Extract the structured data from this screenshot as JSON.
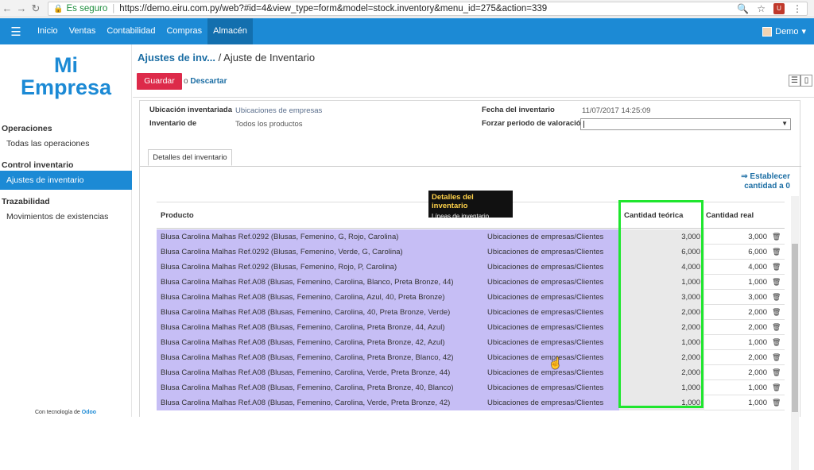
{
  "browser": {
    "secure_label": "Es seguro",
    "url": "https://demo.eiru.com.py/web?#id=4&view_type=form&model=stock.inventory&menu_id=275&action=339"
  },
  "topbar": {
    "menu": [
      "Inicio",
      "Ventas",
      "Contabilidad",
      "Compras",
      "Almacén"
    ],
    "active": "Almacén",
    "user": "Demo"
  },
  "sidebar": {
    "logo_line1": "Mi",
    "logo_line2": "Empresa",
    "sections": [
      {
        "title": "Operaciones",
        "items": [
          "Todas las operaciones"
        ]
      },
      {
        "title": "Control inventario",
        "items": [
          "Ajustes de inventario"
        ]
      },
      {
        "title": "Trazabilidad",
        "items": [
          "Movimientos de existencias"
        ]
      }
    ],
    "powered_prefix": "Con tecnología de",
    "powered_brand": "Odoo"
  },
  "header": {
    "breadcrumb_parent": "Ajustes de inv...",
    "breadcrumb_current": "/ Ajuste de Inventario",
    "save_label": "Guardar",
    "or_label": "o",
    "discard_label": "Descartar"
  },
  "form": {
    "location_label": "Ubicación inventariada",
    "location_value": "Ubicaciones de empresas",
    "inventory_of_label": "Inventario de",
    "inventory_of_value": "Todos los productos",
    "date_label": "Fecha del inventario",
    "date_value": "11/07/2017 14:25:09",
    "force_period_label": "Forzar periodo de valoración",
    "force_period_value": ""
  },
  "tab": {
    "label": "Detalles del inventario",
    "reset_line1": "⇒ Establecer",
    "reset_line2": "cantidad a 0"
  },
  "tooltip": {
    "title": "Detalles del inventario",
    "subtitle": "Líneas de inventario."
  },
  "table": {
    "headers": {
      "product": "Producto",
      "theoretical": "Cantidad teórica",
      "real": "Cantidad real"
    },
    "rows": [
      {
        "product": "Blusa Carolina Malhas Ref.0292 (Blusas, Femenino, G, Rojo, Carolina)",
        "location": "Ubicaciones de empresas/Clientes",
        "theoretical": "3,000",
        "real": "3,000"
      },
      {
        "product": "Blusa Carolina Malhas Ref.0292 (Blusas, Femenino, Verde, G, Carolina)",
        "location": "Ubicaciones de empresas/Clientes",
        "theoretical": "6,000",
        "real": "6,000"
      },
      {
        "product": "Blusa Carolina Malhas Ref.0292 (Blusas, Femenino, Rojo, P, Carolina)",
        "location": "Ubicaciones de empresas/Clientes",
        "theoretical": "4,000",
        "real": "4,000"
      },
      {
        "product": "Blusa Carolina Malhas Ref.A08 (Blusas, Femenino, Carolina, Blanco, Preta Bronze, 44)",
        "location": "Ubicaciones de empresas/Clientes",
        "theoretical": "1,000",
        "real": "1,000"
      },
      {
        "product": "Blusa Carolina Malhas Ref.A08 (Blusas, Femenino, Carolina, Azul, 40, Preta Bronze)",
        "location": "Ubicaciones de empresas/Clientes",
        "theoretical": "3,000",
        "real": "3,000"
      },
      {
        "product": "Blusa Carolina Malhas Ref.A08 (Blusas, Femenino, Carolina, 40, Preta Bronze, Verde)",
        "location": "Ubicaciones de empresas/Clientes",
        "theoretical": "2,000",
        "real": "2,000"
      },
      {
        "product": "Blusa Carolina Malhas Ref.A08 (Blusas, Femenino, Carolina, Preta Bronze, 44, Azul)",
        "location": "Ubicaciones de empresas/Clientes",
        "theoretical": "2,000",
        "real": "2,000"
      },
      {
        "product": "Blusa Carolina Malhas Ref.A08 (Blusas, Femenino, Carolina, Preta Bronze, 42, Azul)",
        "location": "Ubicaciones de empresas/Clientes",
        "theoretical": "1,000",
        "real": "1,000"
      },
      {
        "product": "Blusa Carolina Malhas Ref.A08 (Blusas, Femenino, Carolina, Preta Bronze, Blanco, 42)",
        "location": "Ubicaciones de empresas/Clientes",
        "theoretical": "2,000",
        "real": "2,000"
      },
      {
        "product": "Blusa Carolina Malhas Ref.A08 (Blusas, Femenino, Carolina, Verde, Preta Bronze, 44)",
        "location": "Ubicaciones de empresas/Clientes",
        "theoretical": "2,000",
        "real": "2,000"
      },
      {
        "product": "Blusa Carolina Malhas Ref.A08 (Blusas, Femenino, Carolina, Preta Bronze, 40, Blanco)",
        "location": "Ubicaciones de empresas/Clientes",
        "theoretical": "1,000",
        "real": "1,000"
      },
      {
        "product": "Blusa Carolina Malhas Ref.A08 (Blusas, Femenino, Carolina, Verde, Preta Bronze, 42)",
        "location": "Ubicaciones de empresas/Clientes",
        "theoretical": "1,000",
        "real": "1,000"
      }
    ]
  },
  "colors": {
    "brand": "#1c8ad5",
    "save": "#dd2a4a",
    "row_highlight": "#c6bef5",
    "annotation_box": "#1fe62e"
  }
}
